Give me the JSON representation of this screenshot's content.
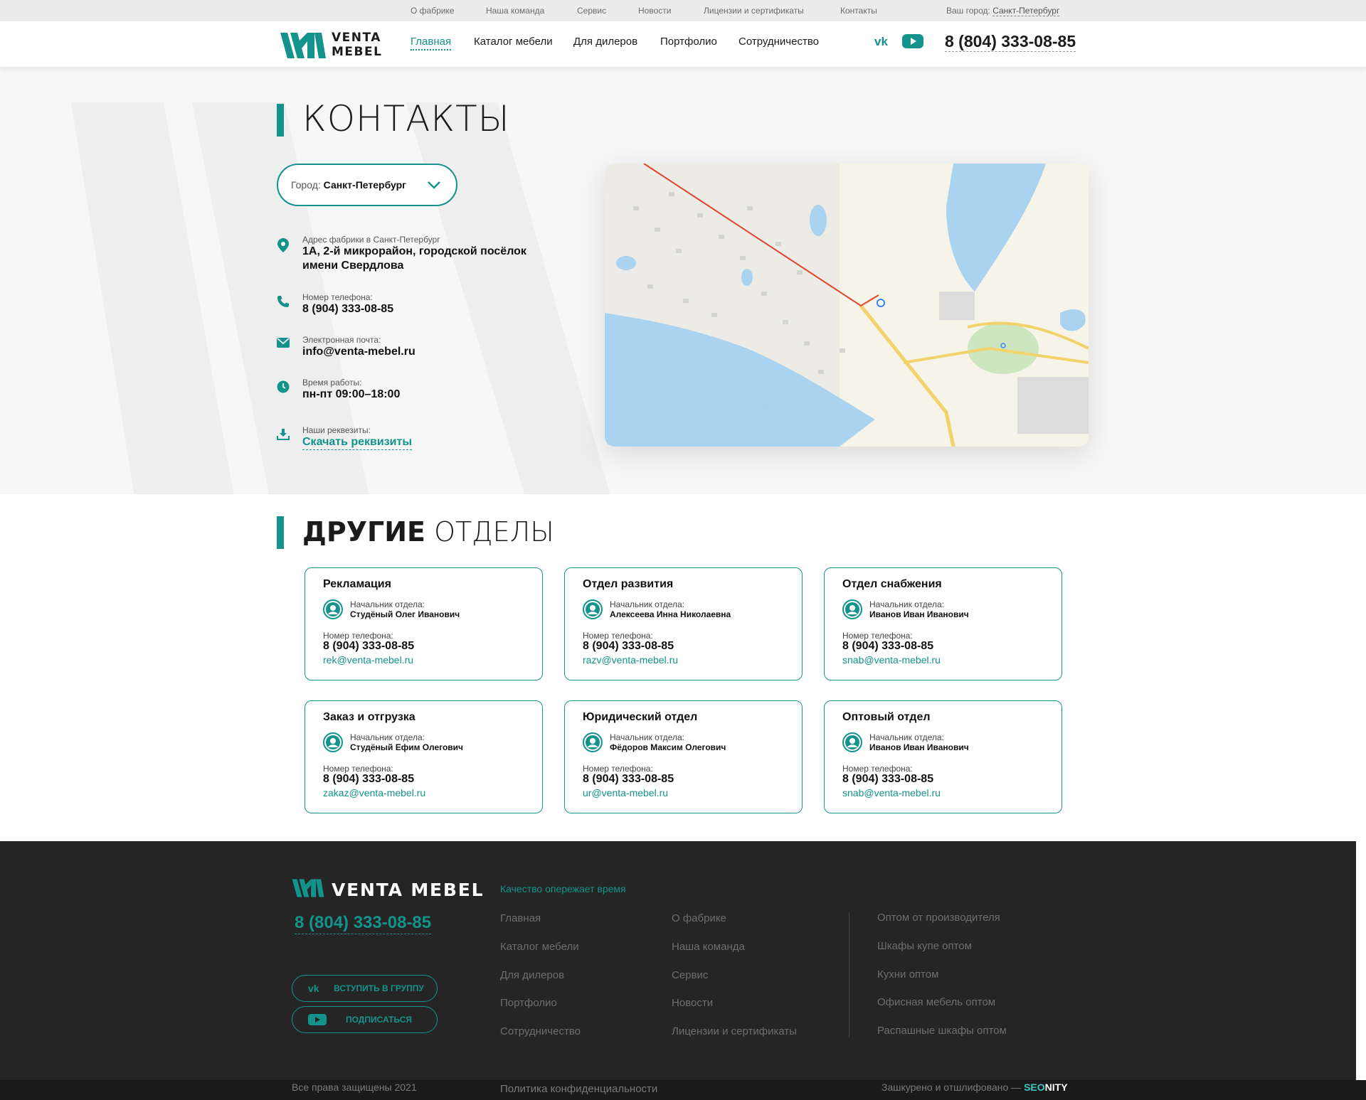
{
  "topbar": {
    "links": [
      "О фабрике",
      "Наша команда",
      "Сервис",
      "Новости",
      "Лицензии и сертификаты",
      "Контакты"
    ],
    "city_label": "Ваш город:",
    "city_value": "Санкт-Петербург"
  },
  "header": {
    "logo_line1": "VENTA",
    "logo_line2": "MEBEL",
    "nav": [
      "Главная",
      "Каталог мебели",
      "Для дилеров",
      "Портфолио",
      "Сотрудничество"
    ],
    "phone": "8 (804) 333-08-85"
  },
  "contacts": {
    "title": "КОНТАКТЫ",
    "city_select_label": "Город:",
    "city_select_value": "Санкт-Петербург",
    "address_label": "Адрес фабрики в Санкт-Петербург",
    "address_value": "1А, 2-й микрорайон, городской посёлок имени Свердлова",
    "phone_label": "Номер телефона:",
    "phone_value": "8 (904) 333-08-85",
    "email_label": "Электронная почта:",
    "email_value": "info@venta-mebel.ru",
    "hours_label": "Время работы:",
    "hours_value": "пн-пт 09:00–18:00",
    "requisites_label": "Наши реквезиты:",
    "requisites_link": "Скачать реквизиты"
  },
  "departments": {
    "title_bold": "ДРУГИЕ",
    "title_light": "ОТДЕЛЫ",
    "head_label": "Начальник отдела:",
    "phone_label": "Номер телефона:",
    "items": [
      {
        "name": "Рекламация",
        "head": "Студёный Олег Иванович",
        "phone": "8 (904) 333-08-85",
        "email": "rek@venta-mebel.ru"
      },
      {
        "name": "Отдел развития",
        "head": "Алексеева Инна Николаевна",
        "phone": "8 (904) 333-08-85",
        "email": "razv@venta-mebel.ru"
      },
      {
        "name": "Отдел снабжения",
        "head": "Иванов Иван Иванович",
        "phone": "8 (904) 333-08-85",
        "email": "snab@venta-mebel.ru"
      },
      {
        "name": "Заказ и отгрузка",
        "head": "Студёный Ефим Олегович",
        "phone": "8 (904) 333-08-85",
        "email": "zakaz@venta-mebel.ru"
      },
      {
        "name": "Юридический отдел",
        "head": "Фёдоров Максим Олегович",
        "phone": "8 (904) 333-08-85",
        "email": "ur@venta-mebel.ru"
      },
      {
        "name": "Оптовый отдел",
        "head": "Иванов Иван Иванович",
        "phone": "8 (904) 333-08-85",
        "email": "snab@venta-mebel.ru"
      }
    ]
  },
  "footer": {
    "logo_text": "VENTA MEBEL",
    "phone": "8 (804) 333-08-85",
    "vk_button": "ВСТУПИТЬ В ГРУППУ",
    "yt_button": "ПОДПИСАТЬСЯ",
    "tagline": "Качество опережает время",
    "col1": [
      "Главная",
      "Каталог мебели",
      "Для дилеров",
      "Портфолио",
      "Сотрудничество"
    ],
    "col2": [
      "О фабрике",
      "Наша команда",
      "Сервис",
      "Новости",
      "Лицензии и сертификаты"
    ],
    "col3": [
      "Оптом от производителя",
      "Шкафы купе оптом",
      "Кухни оптом",
      "Офисная мебель оптом",
      "Распашные шкафы оптом"
    ],
    "copyright": "Все права защищены 2021",
    "privacy": "Политика конфиденциальности",
    "credit": "Зашкурено и отшлифовано —",
    "credit_brand_a": "SEO",
    "credit_brand_b": "NITY"
  },
  "colors": {
    "accent": "#13938c",
    "footer_bg": "#252525",
    "hero_bg": "#f7f7f7"
  },
  "icons": [
    "vk-icon",
    "youtube-icon",
    "location-pin-icon",
    "phone-icon",
    "mail-icon",
    "clock-icon",
    "download-icon",
    "chevron-down-icon",
    "user-avatar-icon"
  ]
}
